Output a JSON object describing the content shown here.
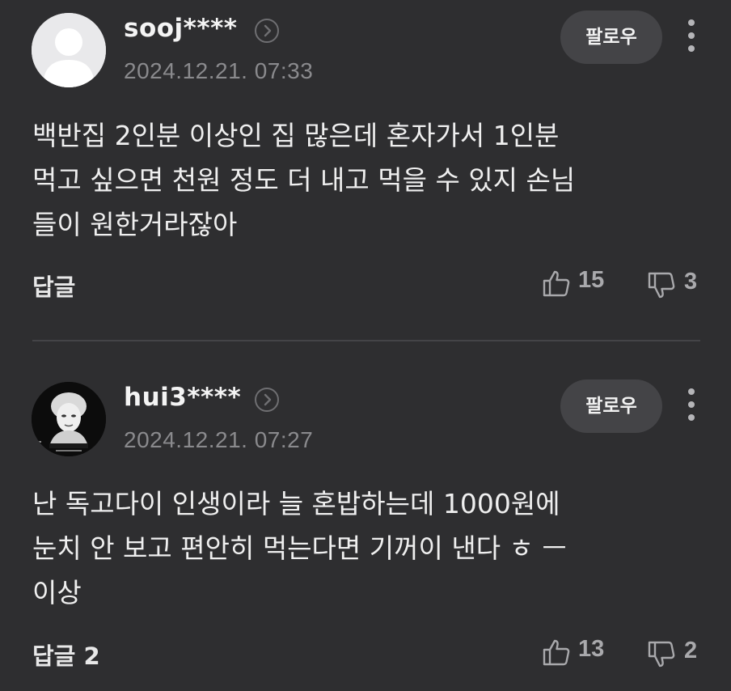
{
  "comments": [
    {
      "username": "sooj****",
      "timestamp": "2024.12.21. 07:33",
      "follow_label": "팔로우",
      "body_lines": [
        "백반집 2인분 이상인 집 많은데 혼자가서 1인분",
        "먹고 싶으면 천원 정도 더 내고 먹을 수 있지 손님",
        "들이 원한거라잖아"
      ],
      "reply_label": "답글",
      "likes": "15",
      "dislikes": "3",
      "avatar": "default-person-icon"
    },
    {
      "username": "hui3****",
      "timestamp": "2024.12.21. 07:27",
      "follow_label": "팔로우",
      "body_lines": [
        "난 독고다이 인생이라 늘 혼밥하는데 1000원에",
        "눈치 안 보고 편안히 먹는다면 기꺼이 낸다 ㅎ ㅡ",
        "이상"
      ],
      "reply_label": "답글 2",
      "likes": "13",
      "dislikes": "2",
      "avatar": "black-and-white-portrait"
    }
  ],
  "icons": {
    "profile_link": "chevron-right-circle-icon",
    "more": "vertical-dots-icon",
    "like": "thumbs-up-icon",
    "dislike": "thumbs-down-icon"
  },
  "colors": {
    "background": "#2e2e30",
    "button": "#444447",
    "muted_text": "#8a8a8d"
  }
}
